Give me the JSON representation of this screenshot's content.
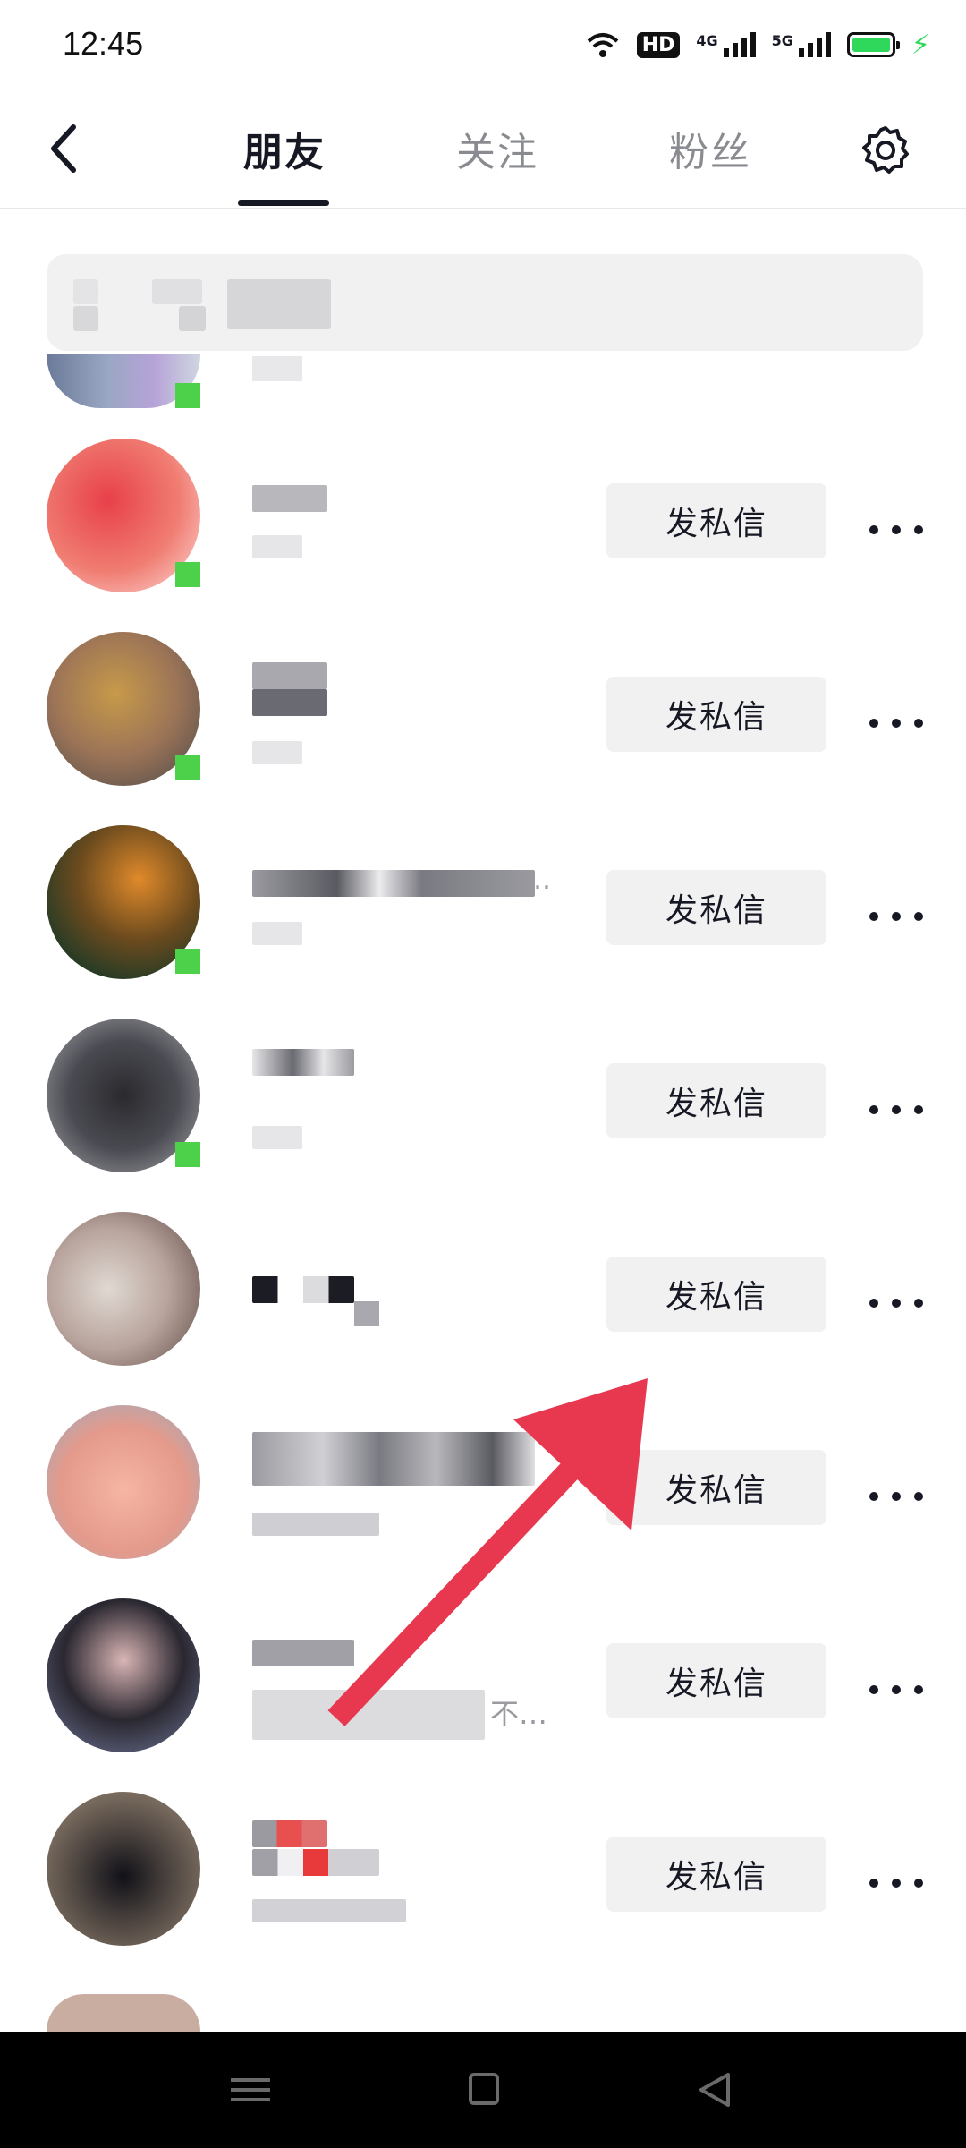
{
  "status_bar": {
    "time": "12:45",
    "hd_label": "HD",
    "net1_label": "4G",
    "net2_label": "5G",
    "icons": [
      "wifi-icon",
      "hd-icon",
      "signal-4g-icon",
      "signal-5g-icon",
      "battery-icon",
      "charging-icon"
    ],
    "battery_color": "#2fd85a"
  },
  "header": {
    "back_icon": "chevron-left-icon",
    "tabs": [
      {
        "label": "朋友",
        "active": true
      },
      {
        "label": "关注",
        "active": false
      },
      {
        "label": "粉丝",
        "active": false
      }
    ],
    "settings_icon": "gear-icon"
  },
  "search": {
    "content": "pixelated (unreadable)"
  },
  "list": {
    "items": [
      {
        "dm_label": "发私信",
        "more_icon": "more-icon"
      },
      {
        "dm_label": "发私信",
        "more_icon": "more-icon"
      },
      {
        "dm_label": "发私信",
        "more_icon": "more-icon"
      },
      {
        "dm_label": "发私信",
        "more_icon": "more-icon"
      },
      {
        "dm_label": "发私信",
        "more_icon": "more-icon"
      },
      {
        "dm_label": "发私信",
        "more_icon": "more-icon"
      },
      {
        "dm_label": "发私信",
        "more_icon": "more-icon"
      },
      {
        "dm_label": "发私信",
        "more_icon": "more-icon"
      }
    ],
    "truncated_text_1": "…",
    "truncated_text_2": "不…"
  },
  "annotation": {
    "arrow_color": "#e8384f"
  },
  "nav_bar": {
    "icons": [
      "recents-icon",
      "home-icon",
      "back-triangle-icon"
    ]
  }
}
